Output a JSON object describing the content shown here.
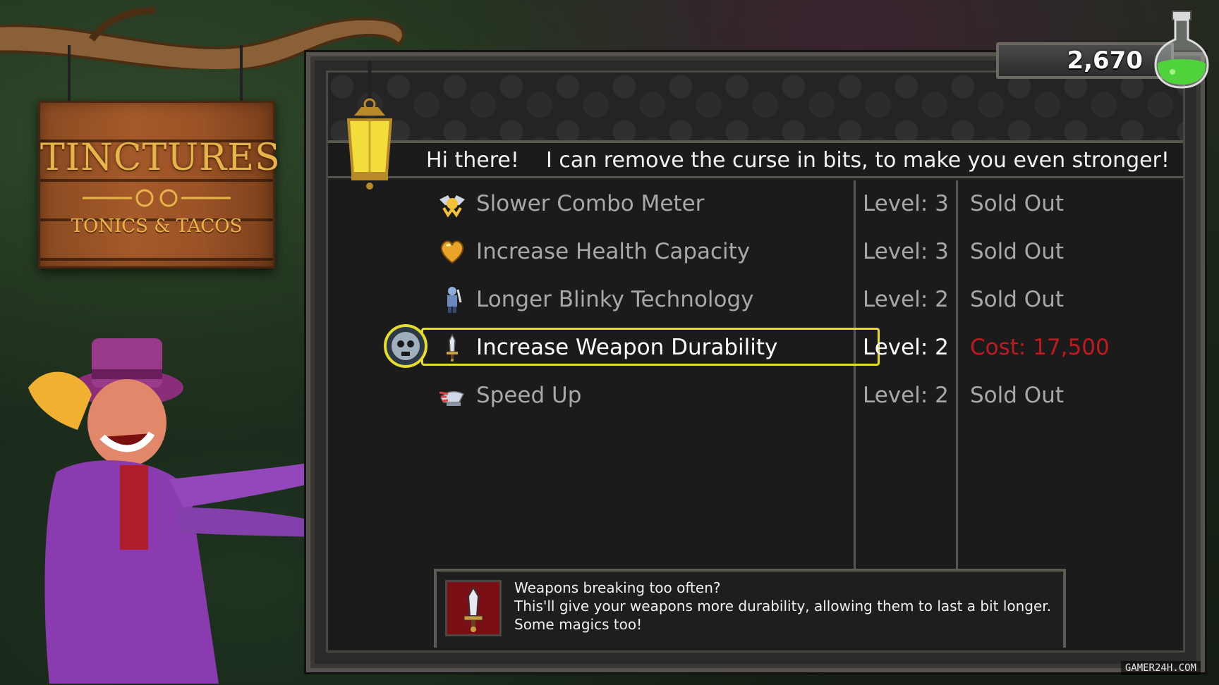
{
  "currency": {
    "value": "2,670",
    "icon": "potion-flask-icon",
    "accent": "#4fd23a"
  },
  "shop_sign": {
    "title": "TINCTURES",
    "subtitle": "TONICS & TACOS"
  },
  "dialog": {
    "greeting": "Hi there!    I can remove the curse in bits, to make you even stronger!"
  },
  "upgrades": [
    {
      "icon": "winged-skull-icon",
      "name": "Slower Combo Meter",
      "level": "Level: 3",
      "price": "Sold Out",
      "selected": false
    },
    {
      "icon": "gold-heart-icon",
      "name": "Increase Health Capacity",
      "level": "Level: 3",
      "price": "Sold Out",
      "selected": false
    },
    {
      "icon": "blinky-knight-icon",
      "name": "Longer Blinky Technology",
      "level": "Level: 2",
      "price": "Sold Out",
      "selected": false
    },
    {
      "icon": "sword-icon",
      "name": "Increase Weapon Durability",
      "level": "Level: 2",
      "price": "Cost: 17,500",
      "selected": true
    },
    {
      "icon": "speed-wing-icon",
      "name": "Speed Up",
      "level": "Level: 2",
      "price": "Sold Out",
      "selected": false
    }
  ],
  "selection": {
    "badge_icon": "skull-cursor-icon",
    "highlight_color": "#e6dd2a",
    "cost_color": "#c01a20"
  },
  "description": {
    "icon": "sword-icon",
    "lines": [
      "Weapons breaking too often?",
      "This'll give your weapons more durability, allowing them to last a bit longer.",
      "Some magics too!"
    ]
  },
  "watermark": "GAMER24H.COM"
}
